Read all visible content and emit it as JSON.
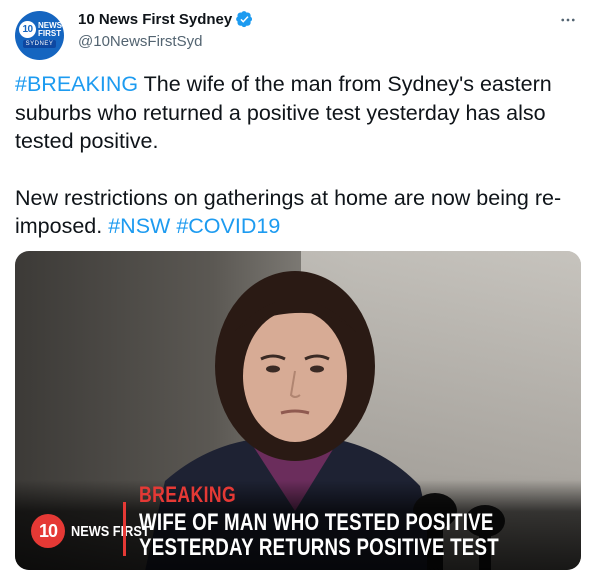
{
  "account": {
    "display_name": "10 News First Sydney",
    "handle": "@10NewsFirstSyd",
    "avatar": {
      "logo_number": "10",
      "logo_text": "NEWS FIRST",
      "city": "SYDNEY"
    },
    "verified": true
  },
  "tweet": {
    "p1_hashtag": "#BREAKING",
    "p1_text": " The wife of the man from Sydney's eastern suburbs who returned a positive test yesterday has also tested positive.",
    "p2_text": "New restrictions on gatherings at home are now being re-imposed. ",
    "p2_hashtag1": "#NSW",
    "p2_space": " ",
    "p2_hashtag2": "#COVID19"
  },
  "media": {
    "logo_number": "10",
    "logo_text": "NEWS FIRST",
    "breaking_label": "BREAKING",
    "headline": "WIFE OF MAN WHO TESTED POSITIVE YESTERDAY RETURNS POSITIVE TEST"
  },
  "icons": {
    "verified": "verified-badge-icon",
    "more": "more-options-icon"
  },
  "colors": {
    "hashtag": "#1d9bf0",
    "verified": "#1d9bf0",
    "brand_red": "#e53935",
    "avatar_blue": "#1565c0"
  }
}
